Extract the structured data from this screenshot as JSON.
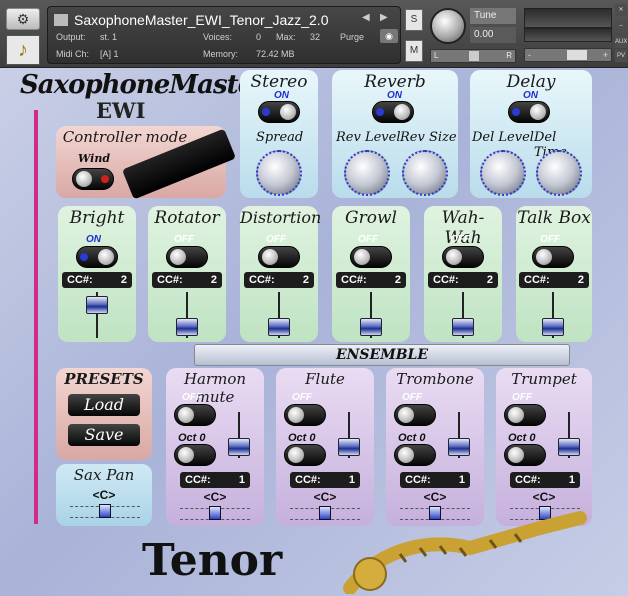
{
  "header": {
    "instrument_name": "SaxophoneMaster_EWI_Tenor_Jazz_2.0",
    "output_label": "Output:",
    "output_value": "st. 1",
    "midi_label": "Midi Ch:",
    "midi_value": "[A] 1",
    "voices_label": "Voices:",
    "voices_value": "0",
    "max_label": "Max:",
    "max_value": "32",
    "memory_label": "Memory:",
    "memory_value": "72.42 MB",
    "purge_label": "Purge",
    "solo_label": "S",
    "mute_label": "M",
    "tune_label": "Tune",
    "tune_value": "0.00",
    "pan_left": "L",
    "pan_right": "R",
    "aux_label": "AUX",
    "pv_label": "PV",
    "vol_minus": "-",
    "vol_plus": "+"
  },
  "logo": {
    "line1": "SaxophoneMaster",
    "line2": "EWI"
  },
  "controller": {
    "title": "Controller mode",
    "wind_label": "Wind"
  },
  "stereo": {
    "title": "Stereo",
    "state": "ON",
    "spread_label": "Spread"
  },
  "reverb": {
    "title": "Reverb",
    "state": "ON",
    "level_label": "Rev Level",
    "size_label": "Rev Size"
  },
  "delay": {
    "title": "Delay",
    "state": "ON",
    "level_label": "Del Level",
    "time_label": "Del Time"
  },
  "effects": [
    {
      "title": "Bright",
      "state": "ON",
      "cc_label": "CC#:",
      "cc_value": "2"
    },
    {
      "title": "Rotator",
      "state": "OFF",
      "cc_label": "CC#:",
      "cc_value": "2"
    },
    {
      "title": "Distortion",
      "state": "OFF",
      "cc_label": "CC#:",
      "cc_value": "2"
    },
    {
      "title": "Growl",
      "state": "OFF",
      "cc_label": "CC#:",
      "cc_value": "2"
    },
    {
      "title": "Wah-Wah",
      "state": "OFF",
      "cc_label": "CC#:",
      "cc_value": "2"
    },
    {
      "title": "Talk Box",
      "state": "OFF",
      "cc_label": "CC#:",
      "cc_value": "2"
    }
  ],
  "ensemble": {
    "title": "ENSEMBLE"
  },
  "presets": {
    "title": "PRESETS",
    "load_label": "Load",
    "save_label": "Save"
  },
  "sax_pan": {
    "title": "Sax Pan",
    "value": "<C>"
  },
  "instruments": [
    {
      "title": "Harmon mute",
      "state": "OFF",
      "oct_label": "Oct 0",
      "cc_label": "CC#:",
      "cc_value": "1",
      "pan": "<C>"
    },
    {
      "title": "Flute",
      "state": "OFF",
      "oct_label": "Oct 0",
      "cc_label": "CC#:",
      "cc_value": "1",
      "pan": "<C>"
    },
    {
      "title": "Trombone",
      "state": "OFF",
      "oct_label": "Oct 0",
      "cc_label": "CC#:",
      "cc_value": "1",
      "pan": "<C>"
    },
    {
      "title": "Trumpet",
      "state": "OFF",
      "oct_label": "Oct 0",
      "cc_label": "CC#:",
      "cc_value": "1",
      "pan": "<C>"
    }
  ],
  "footer": {
    "model_name": "Tenor"
  },
  "colors": {
    "accent_blue": "#1f2fd0",
    "rail_magenta": "#d12b8a",
    "panel_cyan": "#bfe3ef",
    "panel_green": "#cdeccf",
    "panel_pink": "#e9c0bf",
    "panel_purple": "#d7c5e8"
  }
}
